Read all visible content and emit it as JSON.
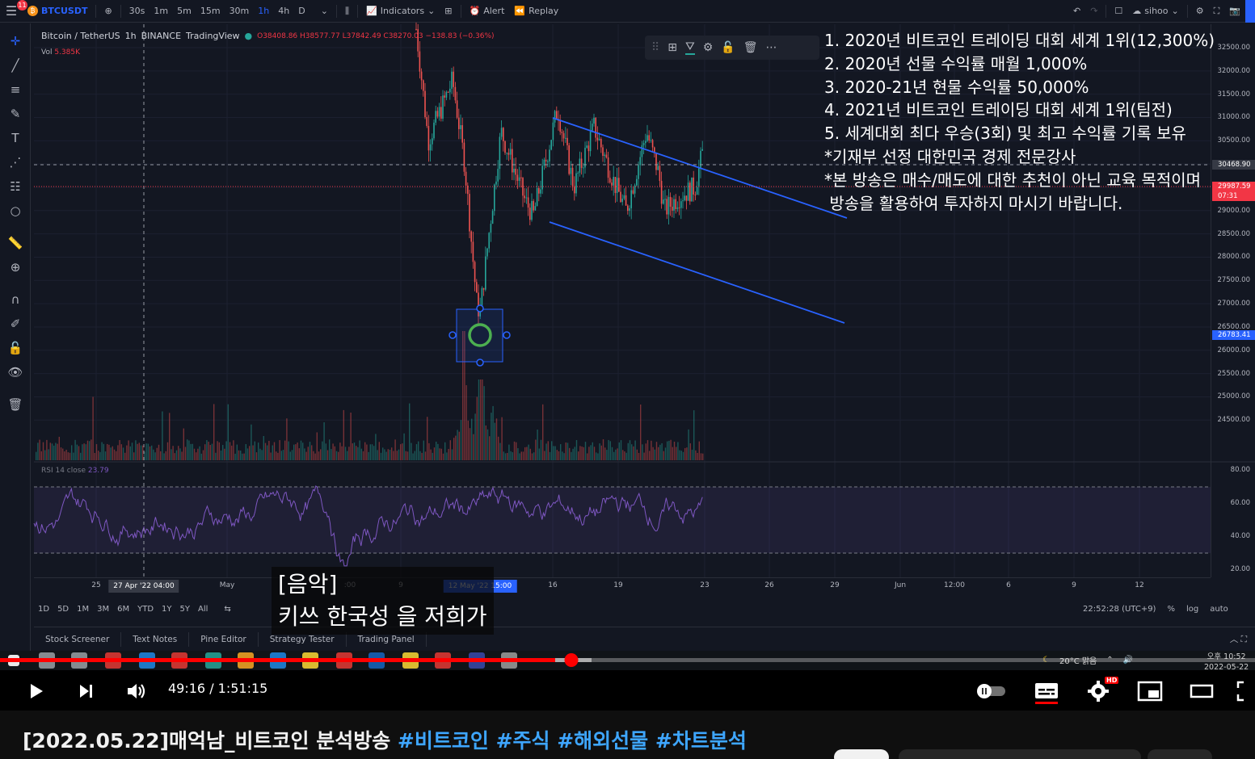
{
  "tradingview": {
    "topbar": {
      "notification_count": "11",
      "symbol": "BTCUSDT",
      "timeframes": [
        "30s",
        "1m",
        "5m",
        "15m",
        "30m",
        "1h",
        "4h",
        "D"
      ],
      "active_timeframe": "1h",
      "indicators_label": "Indicators",
      "alert_label": "Alert",
      "replay_label": "Replay",
      "user_label": "sihoo"
    },
    "legend": {
      "pair": "Bitcoin / TetherUS",
      "interval": "1h",
      "exchange": "BINANCE",
      "source": "TradingView",
      "ohlc": "O38408.86 H38577.77 L37842.49 C38270.03 −138.83 (−0.36%)",
      "vol_name": "Vol",
      "vol_value": "5.385K",
      "rsi_name": "RSI 14 close",
      "rsi_value": "23.79"
    },
    "price_axis": {
      "ticks": [
        "32500.00",
        "32000.00",
        "31500.00",
        "31000.00",
        "30500.00",
        "30000.00",
        "29500.00",
        "29000.00",
        "28500.00",
        "28000.00",
        "27500.00",
        "27000.00",
        "26500.00",
        "26000.00",
        "25500.00",
        "25000.00",
        "24500.00"
      ],
      "crosshair_price": "30468.90",
      "current_price": "29987.59",
      "countdown": "07:31",
      "low_marker": "26783.41",
      "rsi_ticks": [
        "80.00",
        "60.00",
        "40.00",
        "20.00"
      ]
    },
    "overlay_text": [
      "1. 2020년 비트코인 트레이딩 대회 세계 1위(12,300%)",
      "2. 2020년 선물 수익률 매월 1,000%",
      "3. 2020-21년 현물 수익률 50,000%",
      "4. 2021년 비트코인 트레이딩 대회 세계 1위(팀전)",
      "5. 세계대회 최다 우승(3회) 및 최고 수익률 기록 보유",
      "*기재부 선정 대한민국 경제 전문강사",
      "*본 방송은 매수/매도에 대한 추천이 아닌 교육 목적이며",
      " 방송을 활용하여 투자하지 마시기 바랍니다."
    ],
    "time_axis": {
      "labels": [
        "25",
        "May",
        "9",
        "16",
        "19",
        "23",
        "26",
        "29",
        "Jun",
        "12:00",
        "6",
        "9",
        "12"
      ],
      "crosshair_time": "27 Apr '22   04:00",
      "highlight_time": "12 May '22   15:00",
      "partial_label": ":00"
    },
    "range_buttons": [
      "1D",
      "5D",
      "1M",
      "3M",
      "6M",
      "YTD",
      "1Y",
      "5Y",
      "All"
    ],
    "clock_text": "22:52:28 (UTC+9)",
    "scale_options": [
      "%",
      "log",
      "auto"
    ],
    "bottom_tabs": [
      "Stock Screener",
      "Text Notes",
      "Pine Editor",
      "Strategy Tester",
      "Trading Panel"
    ]
  },
  "captions": {
    "line1": "[음악]",
    "line2": "키쓰 한국성 을 저희가"
  },
  "windows_taskbar": {
    "weather": "20°C 맑음",
    "time": "오후 10:52",
    "date": "2022-05-22"
  },
  "player": {
    "current_time": "49:16",
    "duration": "1:51:15",
    "time_display": "49:16 / 1:51:15",
    "progress_fraction": 0.4426,
    "buffer_fraction": 0.4713,
    "hd_badge": "HD",
    "accent_color": "#ff0000"
  },
  "video": {
    "title_prefix": "[2022.05.22]매억남_비트코인 분석방송 ",
    "hashtags": [
      "#비트코인",
      "#주식",
      "#해외선물",
      "#차트분석"
    ]
  },
  "colors": {
    "up": "#26a69a",
    "down": "#ef5350",
    "trendline": "#2962ff",
    "rsi": "#7e57c2",
    "hashtag": "#3ea6ff"
  }
}
